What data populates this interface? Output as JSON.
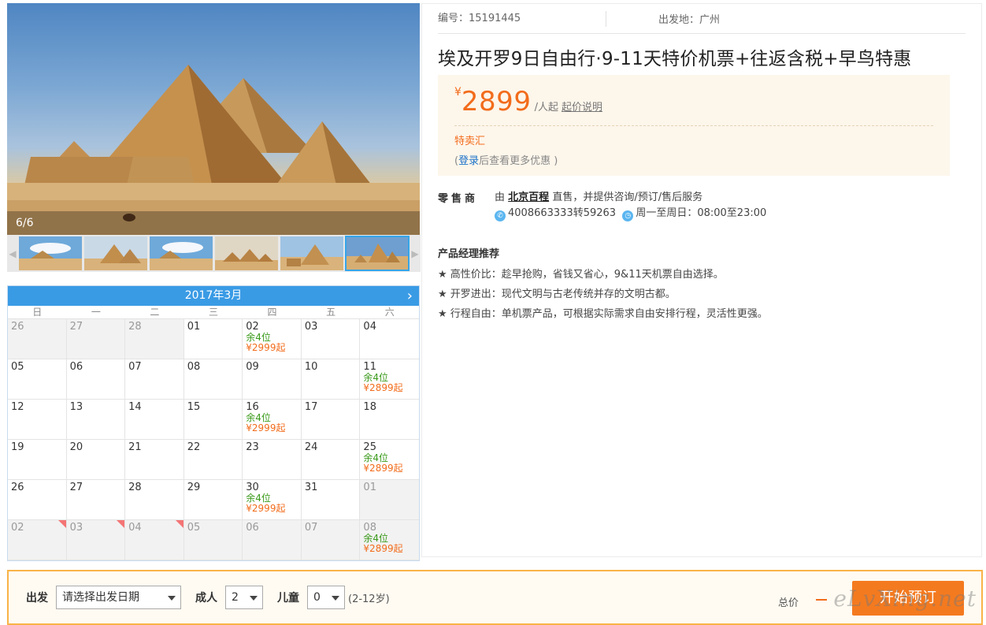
{
  "gallery": {
    "counter": "6/6",
    "thumb_count": 6,
    "active_index": 5
  },
  "calendar": {
    "month_label": "2017年3月",
    "weekdays": [
      "日",
      "一",
      "二",
      "三",
      "四",
      "五",
      "六"
    ],
    "days": [
      {
        "d": "26",
        "muted": true
      },
      {
        "d": "27",
        "muted": true
      },
      {
        "d": "28",
        "muted": true
      },
      {
        "d": "01"
      },
      {
        "d": "02",
        "seats": "余4位",
        "price": "¥2999起"
      },
      {
        "d": "03"
      },
      {
        "d": "04"
      },
      {
        "d": "05"
      },
      {
        "d": "06"
      },
      {
        "d": "07"
      },
      {
        "d": "08"
      },
      {
        "d": "09"
      },
      {
        "d": "10"
      },
      {
        "d": "11",
        "seats": "余4位",
        "price": "¥2899起"
      },
      {
        "d": "12"
      },
      {
        "d": "13"
      },
      {
        "d": "14"
      },
      {
        "d": "15"
      },
      {
        "d": "16",
        "seats": "余4位",
        "price": "¥2999起"
      },
      {
        "d": "17"
      },
      {
        "d": "18"
      },
      {
        "d": "19"
      },
      {
        "d": "20"
      },
      {
        "d": "21"
      },
      {
        "d": "22"
      },
      {
        "d": "23"
      },
      {
        "d": "24"
      },
      {
        "d": "25",
        "seats": "余4位",
        "price": "¥2899起"
      },
      {
        "d": "26"
      },
      {
        "d": "27"
      },
      {
        "d": "28"
      },
      {
        "d": "29"
      },
      {
        "d": "30",
        "seats": "余4位",
        "price": "¥2999起"
      },
      {
        "d": "31"
      },
      {
        "d": "01",
        "muted": true
      },
      {
        "d": "02",
        "muted": true,
        "corner": true
      },
      {
        "d": "03",
        "muted": true,
        "corner": true
      },
      {
        "d": "04",
        "muted": true,
        "corner": true
      },
      {
        "d": "05",
        "muted": true
      },
      {
        "d": "06",
        "muted": true
      },
      {
        "d": "07",
        "muted": true
      },
      {
        "d": "08",
        "muted": true,
        "seats": "余4位",
        "price": "¥2899起"
      }
    ]
  },
  "product": {
    "code": "编号：15191445",
    "departure": "出发地：广州",
    "title": "埃及开罗9日自由行·9-11天特价机票+往返含税+早鸟特惠",
    "currency": "¥",
    "price": "2899",
    "per": "/人起",
    "price_explain": "起价说明",
    "promo": "特卖汇",
    "login_prefix": "(",
    "login_link": "登录",
    "login_suffix": "后查看更多优惠 )"
  },
  "seller": {
    "label": "零售商",
    "by": "由",
    "name": "北京百程",
    "desc": "直售，并提供咨询/预订/售后服务",
    "phone": "4008663333转59263",
    "hours": "周一至周日：08:00至23:00"
  },
  "recommend": {
    "title": "产品经理推荐",
    "items": [
      "★ 高性价比：趁早抢购，省钱又省心，9&11天机票自由选择。",
      "★ 开罗进出：现代文明与古老传统并存的文明古都。",
      "★ 行程自由：单机票产品，可根据实际需求自由安排行程，灵活性更强。"
    ]
  },
  "booking": {
    "depart_label": "出发",
    "depart_value": "请选择出发日期",
    "adult_label": "成人",
    "adult_value": "2",
    "child_label": "儿童",
    "child_value": "0",
    "child_note": "(2-12岁)",
    "total_label": "总价",
    "button": "开始预订",
    "watermark": "eLvXing.net"
  },
  "colors": {
    "accent": "#f26c1b",
    "calendar_head": "#3a9be5",
    "green": "#3a9a1a",
    "bar_border": "#f9b347"
  }
}
